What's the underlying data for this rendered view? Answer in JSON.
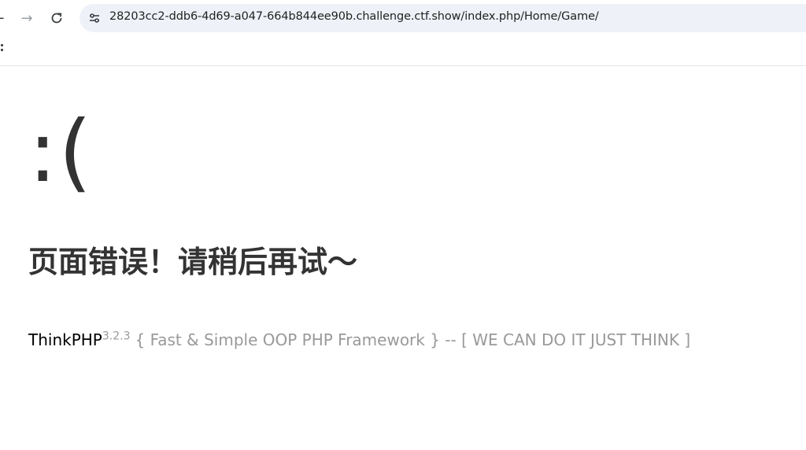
{
  "browser": {
    "url": "28203cc2-ddb6-4d69-a047-664b844ee90b.challenge.ctf.show/index.php/Home/Game/",
    "icons": {
      "back": "arrow-left-icon",
      "forward": "arrow-right-icon",
      "reload": "reload-icon",
      "site_info": "tune-icon",
      "apps": "apps-grid-icon"
    }
  },
  "error_page": {
    "face": ":(",
    "message": "页面错误！请稍后再试～",
    "framework": "ThinkPHP",
    "version": "3.2.3",
    "slogan": "{ Fast & Simple OOP PHP Framework } -- [ WE CAN DO IT JUST THINK ]"
  },
  "colors": {
    "text_dark": "#333333",
    "text_muted": "#999999",
    "omnibox_bg": "#eef2f8"
  }
}
